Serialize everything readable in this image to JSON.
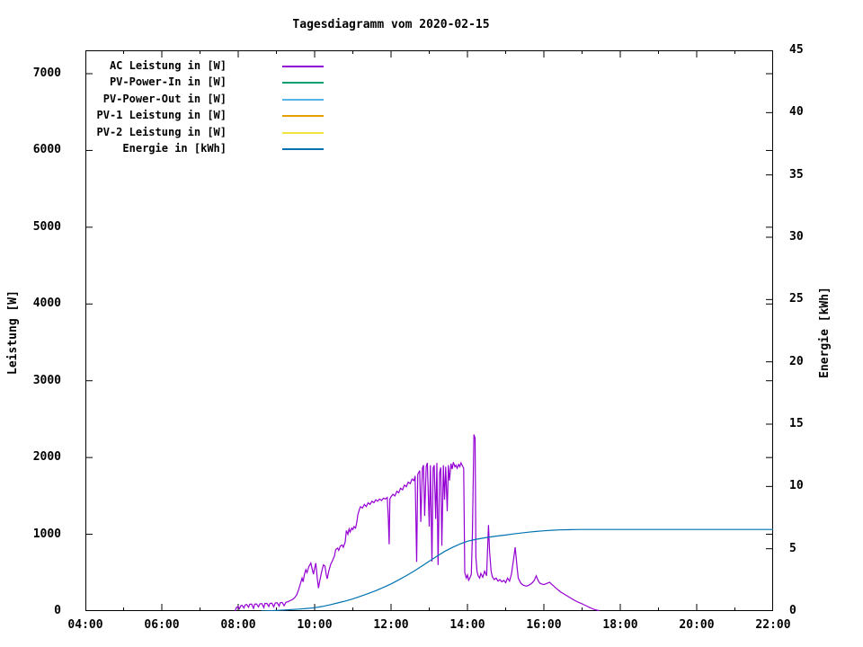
{
  "chart_data": {
    "type": "line",
    "title": "Tagesdiagramm vom 2020-02-15",
    "y_axis": {
      "label": "Leistung [W]",
      "ticks": [
        0,
        1000,
        2000,
        3000,
        4000,
        5000,
        6000,
        7000
      ],
      "range": [
        0,
        7300
      ]
    },
    "y2_axis": {
      "label": "Energie [kWh]",
      "ticks": [
        0,
        5,
        10,
        15,
        20,
        25,
        30,
        35,
        40,
        45
      ],
      "range": [
        0,
        45
      ]
    },
    "x_axis": {
      "range_hours": [
        4,
        22
      ],
      "ticks_major": [
        {
          "h": 4,
          "label": "04:00"
        },
        {
          "h": 6,
          "label": "06:00"
        },
        {
          "h": 8,
          "label": "08:00"
        },
        {
          "h": 10,
          "label": "10:00"
        },
        {
          "h": 12,
          "label": "12:00"
        },
        {
          "h": 14,
          "label": "14:00"
        },
        {
          "h": 16,
          "label": "16:00"
        },
        {
          "h": 18,
          "label": "18:00"
        },
        {
          "h": 20,
          "label": "20:00"
        },
        {
          "h": 22,
          "label": "22:00"
        }
      ],
      "ticks_minor_hours": [
        5,
        7,
        9,
        11,
        13,
        15,
        17,
        19,
        21
      ]
    },
    "legend": [
      {
        "label": "AC Leistung in [W]",
        "color": "#9400d3"
      },
      {
        "label": "PV-Power-In in [W]",
        "color": "#009e73"
      },
      {
        "label": "PV-Power-Out in [W]",
        "color": "#56b4e9"
      },
      {
        "label": "PV-1 Leistung in [W]",
        "color": "#e69f00"
      },
      {
        "label": "PV-2 Leistung in [W]",
        "color": "#f0e442"
      },
      {
        "label": "Energie in [kWh]",
        "color": "#0072b2"
      }
    ],
    "series": [
      {
        "name": "AC Leistung in [W]",
        "axis": "y1",
        "color": "#9400d3",
        "points": [
          [
            7.92,
            0
          ],
          [
            7.95,
            45
          ],
          [
            8.0,
            60
          ],
          [
            8.03,
            30
          ],
          [
            8.07,
            70
          ],
          [
            8.1,
            75
          ],
          [
            8.15,
            40
          ],
          [
            8.18,
            80
          ],
          [
            8.22,
            85
          ],
          [
            8.27,
            50
          ],
          [
            8.3,
            88
          ],
          [
            8.35,
            90
          ],
          [
            8.4,
            35
          ],
          [
            8.43,
            90
          ],
          [
            8.48,
            92
          ],
          [
            8.53,
            55
          ],
          [
            8.57,
            95
          ],
          [
            8.62,
            97
          ],
          [
            8.67,
            45
          ],
          [
            8.7,
            98
          ],
          [
            8.75,
            100
          ],
          [
            8.8,
            60
          ],
          [
            8.83,
            100
          ],
          [
            8.88,
            103
          ],
          [
            8.93,
            55
          ],
          [
            8.97,
            105
          ],
          [
            9.02,
            108
          ],
          [
            9.07,
            65
          ],
          [
            9.1,
            108
          ],
          [
            9.15,
            112
          ],
          [
            9.2,
            70
          ],
          [
            9.25,
            115
          ],
          [
            9.3,
            120
          ],
          [
            9.35,
            135
          ],
          [
            9.42,
            150
          ],
          [
            9.47,
            170
          ],
          [
            9.53,
            210
          ],
          [
            9.58,
            280
          ],
          [
            9.63,
            360
          ],
          [
            9.67,
            430
          ],
          [
            9.7,
            380
          ],
          [
            9.73,
            470
          ],
          [
            9.77,
            540
          ],
          [
            9.8,
            500
          ],
          [
            9.85,
            580
          ],
          [
            9.9,
            625
          ],
          [
            9.93,
            560
          ],
          [
            9.97,
            480
          ],
          [
            10.0,
            560
          ],
          [
            10.03,
            625
          ],
          [
            10.07,
            420
          ],
          [
            10.1,
            300
          ],
          [
            10.13,
            380
          ],
          [
            10.17,
            480
          ],
          [
            10.2,
            545
          ],
          [
            10.23,
            600
          ],
          [
            10.27,
            585
          ],
          [
            10.3,
            480
          ],
          [
            10.33,
            420
          ],
          [
            10.37,
            520
          ],
          [
            10.42,
            610
          ],
          [
            10.47,
            660
          ],
          [
            10.52,
            720
          ],
          [
            10.55,
            800
          ],
          [
            10.6,
            820
          ],
          [
            10.63,
            790
          ],
          [
            10.67,
            845
          ],
          [
            10.72,
            860
          ],
          [
            10.75,
            830
          ],
          [
            10.8,
            900
          ],
          [
            10.83,
            1050
          ],
          [
            10.87,
            1000
          ],
          [
            10.9,
            1070
          ],
          [
            10.93,
            1030
          ],
          [
            10.97,
            1080
          ],
          [
            11.0,
            1060
          ],
          [
            11.03,
            1100
          ],
          [
            11.07,
            1080
          ],
          [
            11.1,
            1150
          ],
          [
            11.13,
            1250
          ],
          [
            11.17,
            1320
          ],
          [
            11.2,
            1360
          ],
          [
            11.25,
            1340
          ],
          [
            11.3,
            1390
          ],
          [
            11.35,
            1360
          ],
          [
            11.4,
            1410
          ],
          [
            11.45,
            1390
          ],
          [
            11.5,
            1430
          ],
          [
            11.55,
            1410
          ],
          [
            11.6,
            1450
          ],
          [
            11.65,
            1430
          ],
          [
            11.7,
            1460
          ],
          [
            11.75,
            1440
          ],
          [
            11.8,
            1470
          ],
          [
            11.85,
            1460
          ],
          [
            11.9,
            1480
          ],
          [
            11.93,
            1200
          ],
          [
            11.95,
            870
          ],
          [
            11.97,
            1460
          ],
          [
            12.0,
            1490
          ],
          [
            12.05,
            1520
          ],
          [
            12.1,
            1500
          ],
          [
            12.15,
            1560
          ],
          [
            12.2,
            1540
          ],
          [
            12.25,
            1600
          ],
          [
            12.3,
            1580
          ],
          [
            12.35,
            1640
          ],
          [
            12.4,
            1620
          ],
          [
            12.45,
            1680
          ],
          [
            12.5,
            1660
          ],
          [
            12.55,
            1720
          ],
          [
            12.6,
            1700
          ],
          [
            12.63,
            1760
          ],
          [
            12.67,
            640
          ],
          [
            12.7,
            1780
          ],
          [
            12.75,
            1830
          ],
          [
            12.78,
            1160
          ],
          [
            12.82,
            1860
          ],
          [
            12.85,
            1900
          ],
          [
            12.88,
            1240
          ],
          [
            12.92,
            1880
          ],
          [
            12.95,
            1930
          ],
          [
            13.0,
            1100
          ],
          [
            13.03,
            1900
          ],
          [
            13.07,
            645
          ],
          [
            13.1,
            1860
          ],
          [
            13.13,
            1900
          ],
          [
            13.17,
            1200
          ],
          [
            13.2,
            1930
          ],
          [
            13.23,
            600
          ],
          [
            13.27,
            1800
          ],
          [
            13.3,
            1870
          ],
          [
            13.33,
            850
          ],
          [
            13.37,
            1900
          ],
          [
            13.4,
            1450
          ],
          [
            13.43,
            1880
          ],
          [
            13.47,
            1300
          ],
          [
            13.5,
            1900
          ],
          [
            13.53,
            1700
          ],
          [
            13.57,
            1920
          ],
          [
            13.6,
            1850
          ],
          [
            13.63,
            1940
          ],
          [
            13.67,
            1880
          ],
          [
            13.7,
            1900
          ],
          [
            13.73,
            1860
          ],
          [
            13.77,
            1910
          ],
          [
            13.8,
            1880
          ],
          [
            13.83,
            1930
          ],
          [
            13.87,
            1890
          ],
          [
            13.9,
            1860
          ],
          [
            13.93,
            500
          ],
          [
            13.97,
            430
          ],
          [
            14.0,
            470
          ],
          [
            14.03,
            400
          ],
          [
            14.07,
            440
          ],
          [
            14.1,
            480
          ],
          [
            14.13,
            1000
          ],
          [
            14.17,
            2300
          ],
          [
            14.2,
            2250
          ],
          [
            14.22,
            700
          ],
          [
            14.25,
            520
          ],
          [
            14.28,
            460
          ],
          [
            14.32,
            430
          ],
          [
            14.35,
            490
          ],
          [
            14.4,
            440
          ],
          [
            14.45,
            520
          ],
          [
            14.5,
            460
          ],
          [
            14.55,
            1120
          ],
          [
            14.58,
            780
          ],
          [
            14.62,
            520
          ],
          [
            14.65,
            450
          ],
          [
            14.7,
            410
          ],
          [
            14.75,
            430
          ],
          [
            14.8,
            390
          ],
          [
            14.85,
            410
          ],
          [
            14.9,
            380
          ],
          [
            14.95,
            400
          ],
          [
            15.0,
            370
          ],
          [
            15.05,
            430
          ],
          [
            15.1,
            390
          ],
          [
            15.15,
            480
          ],
          [
            15.2,
            650
          ],
          [
            15.25,
            830
          ],
          [
            15.3,
            560
          ],
          [
            15.33,
            430
          ],
          [
            15.37,
            390
          ],
          [
            15.4,
            360
          ],
          [
            15.45,
            340
          ],
          [
            15.5,
            330
          ],
          [
            15.55,
            325
          ],
          [
            15.6,
            335
          ],
          [
            15.65,
            350
          ],
          [
            15.7,
            370
          ],
          [
            15.75,
            400
          ],
          [
            15.8,
            460
          ],
          [
            15.83,
            420
          ],
          [
            15.87,
            380
          ],
          [
            15.9,
            360
          ],
          [
            15.95,
            350
          ],
          [
            16.0,
            345
          ],
          [
            16.05,
            355
          ],
          [
            16.1,
            365
          ],
          [
            16.15,
            375
          ],
          [
            16.2,
            350
          ],
          [
            16.25,
            330
          ],
          [
            16.3,
            305
          ],
          [
            16.35,
            285
          ],
          [
            16.4,
            265
          ],
          [
            16.45,
            245
          ],
          [
            16.5,
            230
          ],
          [
            16.55,
            215
          ],
          [
            16.6,
            200
          ],
          [
            16.65,
            185
          ],
          [
            16.7,
            170
          ],
          [
            16.75,
            155
          ],
          [
            16.8,
            140
          ],
          [
            16.85,
            128
          ],
          [
            16.9,
            115
          ],
          [
            16.95,
            105
          ],
          [
            17.0,
            95
          ],
          [
            17.05,
            82
          ],
          [
            17.1,
            70
          ],
          [
            17.15,
            58
          ],
          [
            17.2,
            46
          ],
          [
            17.25,
            35
          ],
          [
            17.3,
            25
          ],
          [
            17.35,
            16
          ],
          [
            17.4,
            10
          ],
          [
            17.45,
            6
          ]
        ]
      },
      {
        "name": "Energie in [kWh]",
        "axis": "y2",
        "color": "#0072b2",
        "points": [
          [
            8.6,
            0
          ],
          [
            8.8,
            0.02
          ],
          [
            9.0,
            0.05
          ],
          [
            9.2,
            0.08
          ],
          [
            9.4,
            0.12
          ],
          [
            9.6,
            0.16
          ],
          [
            9.8,
            0.21
          ],
          [
            10.0,
            0.27
          ],
          [
            10.2,
            0.37
          ],
          [
            10.4,
            0.5
          ],
          [
            10.6,
            0.65
          ],
          [
            10.8,
            0.8
          ],
          [
            11.0,
            0.98
          ],
          [
            11.2,
            1.18
          ],
          [
            11.4,
            1.4
          ],
          [
            11.6,
            1.64
          ],
          [
            11.8,
            1.9
          ],
          [
            12.0,
            2.18
          ],
          [
            12.2,
            2.5
          ],
          [
            12.4,
            2.84
          ],
          [
            12.6,
            3.2
          ],
          [
            12.8,
            3.6
          ],
          [
            13.0,
            4.0
          ],
          [
            13.2,
            4.4
          ],
          [
            13.4,
            4.78
          ],
          [
            13.6,
            5.1
          ],
          [
            13.8,
            5.38
          ],
          [
            14.0,
            5.6
          ],
          [
            14.2,
            5.74
          ],
          [
            14.4,
            5.85
          ],
          [
            14.6,
            5.95
          ],
          [
            14.8,
            6.03
          ],
          [
            15.0,
            6.1
          ],
          [
            15.2,
            6.19
          ],
          [
            15.4,
            6.26
          ],
          [
            15.6,
            6.33
          ],
          [
            15.8,
            6.39
          ],
          [
            16.0,
            6.44
          ],
          [
            16.2,
            6.48
          ],
          [
            16.4,
            6.51
          ],
          [
            16.6,
            6.53
          ],
          [
            16.8,
            6.54
          ],
          [
            17.0,
            6.55
          ],
          [
            17.5,
            6.55
          ],
          [
            18.0,
            6.55
          ],
          [
            19.0,
            6.55
          ],
          [
            20.0,
            6.55
          ],
          [
            21.0,
            6.55
          ],
          [
            22.0,
            6.55
          ]
        ]
      }
    ],
    "layout": {
      "grid": false,
      "legend_position": "top-left-inside",
      "border_color": "#000000",
      "background": "#ffffff"
    }
  }
}
